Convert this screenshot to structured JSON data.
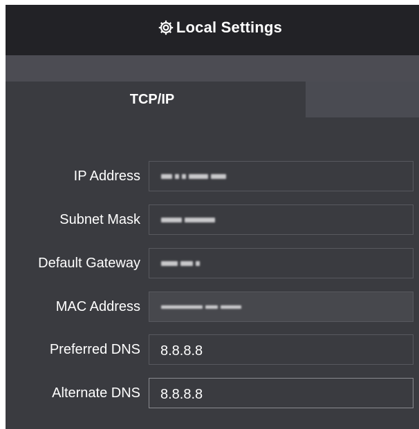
{
  "header": {
    "title": "Local Settings",
    "icon": "gear-icon"
  },
  "tabs": [
    {
      "label": "TCP/IP",
      "active": true
    }
  ],
  "form": {
    "ip_address": {
      "label": "IP Address",
      "value": "",
      "obscured": true
    },
    "subnet_mask": {
      "label": "Subnet Mask",
      "value": "",
      "obscured": true
    },
    "default_gateway": {
      "label": "Default Gateway",
      "value": "",
      "obscured": true
    },
    "mac_address": {
      "label": "MAC Address",
      "value": "",
      "obscured": true,
      "readonly": true
    },
    "preferred_dns": {
      "label": "Preferred DNS",
      "value": "8.8.8.8"
    },
    "alternate_dns": {
      "label": "Alternate DNS",
      "value": "8.8.8.8"
    }
  },
  "colors": {
    "panel_bg": "#3a3b40",
    "header_bg": "#222226",
    "tab_strip_bg": "#4c4c53",
    "text": "#ffffff",
    "field_border": "#58595f"
  }
}
